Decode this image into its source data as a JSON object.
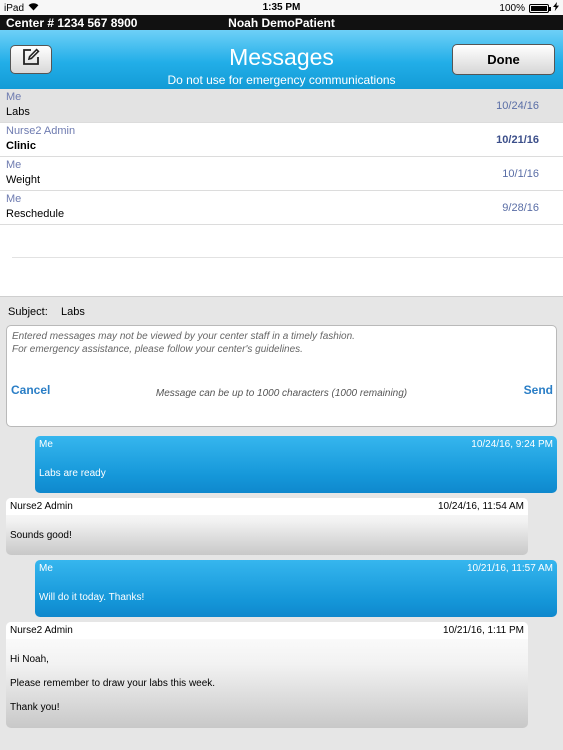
{
  "status_bar": {
    "device": "iPad",
    "time": "1:35 PM",
    "battery": "100%",
    "battery_level": 1.0
  },
  "center_bar": {
    "center_number": "Center # 1234 567 8900",
    "patient_name": "Noah DemoPatient"
  },
  "header": {
    "title": "Messages",
    "subtitle": "Do not use for emergency communications",
    "done_label": "Done"
  },
  "inbox": [
    {
      "sender": "Me",
      "subject": "Labs",
      "date": "10/24/16"
    },
    {
      "sender": "Nurse2 Admin",
      "subject": "Clinic",
      "date": "10/21/16"
    },
    {
      "sender": "Me",
      "subject": "Weight",
      "date": "10/1/16"
    },
    {
      "sender": "Me",
      "subject": "Reschedule",
      "date": "9/28/16"
    }
  ],
  "compose": {
    "subject_label": "Subject:",
    "subject_value": "Labs",
    "placeholder_line1": "Entered messages may not be viewed by your center staff in a timely fashion.",
    "placeholder_line2": "For emergency assistance, please follow your center's guidelines.",
    "cancel_label": "Cancel",
    "send_label": "Send",
    "counter": "Message can be up to 1000 characters (1000 remaining)"
  },
  "thread": [
    {
      "sender": "Me",
      "timestamp": "10/24/16, 9:24 PM",
      "lines": [
        "Labs are ready"
      ]
    },
    {
      "sender": "Nurse2 Admin",
      "timestamp": "10/24/16, 11:54 AM",
      "lines": [
        "Sounds good!"
      ]
    },
    {
      "sender": "Me",
      "timestamp": "10/21/16, 11:57 AM",
      "lines": [
        "Will do it today. Thanks!"
      ]
    },
    {
      "sender": "Nurse2 Admin",
      "timestamp": "10/21/16, 1:11 PM",
      "lines": [
        "Hi Noah,",
        "Please remember to draw your labs this week.",
        "Thank you!"
      ]
    }
  ],
  "colors": {
    "accent": "#22aee8",
    "link": "#2a7ec6",
    "sender_meta": "#6e7bb0"
  },
  "icons": {
    "compose": "compose-icon",
    "wifi": "wifi-icon",
    "charging": "bolt-icon"
  }
}
